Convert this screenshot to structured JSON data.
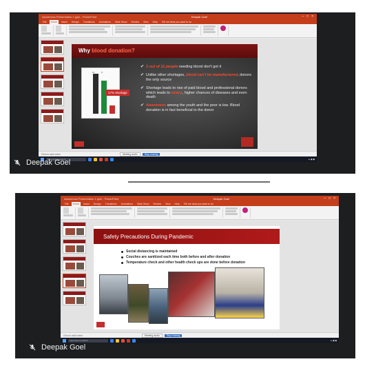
{
  "participants": [
    {
      "name": "Deepak Goel",
      "muted_icon": "mic-off-icon",
      "window": {
        "title": "Awareness Presentation 1.pptx - PowerPoint",
        "user": "Deepak Goel",
        "tabs": [
          "File",
          "Home",
          "Insert",
          "Design",
          "Transitions",
          "Animations",
          "Slide Show",
          "Review",
          "View",
          "Help",
          "Tell me what you want to do"
        ],
        "active_tab": "Home"
      },
      "slide": {
        "title_prefix": "Why ",
        "title_highlight": "blood donation?",
        "chart_labels": [
          "11",
          "9"
        ],
        "shortage_label": "17% shortage",
        "bullets": [
          {
            "em": "1 out of 11 people",
            "text": " needing blood don't get it"
          },
          {
            "pre": "Unlike other shortages, ",
            "em": "blood can't be manufactured",
            "text": ", donors the only source"
          },
          {
            "pre": "Shortage leads to rise of paid blood and professional donors which leads to ",
            "em": "stress",
            "text": ", higher chances of diseases and even death"
          },
          {
            "em": "Awareness",
            "text": " among the youth and the poor is low. Blood donation is in fact beneficial to the donor"
          }
        ]
      },
      "status": {
        "notes": "Click to add notes",
        "share": "Stop sharing",
        "mic": "Meeting audio"
      },
      "taskbar_search": "Type here to search"
    },
    {
      "name": "Deepak Goel",
      "muted_icon": "mic-off-icon",
      "window": {
        "title": "Awareness Presentation 1.pptx - PowerPoint",
        "user": "Deepak Goel",
        "tabs": [
          "File",
          "Home",
          "Insert",
          "Design",
          "Transitions",
          "Animations",
          "Slide Show",
          "Review",
          "View",
          "Help",
          "Tell me what you want to do"
        ],
        "active_tab": "Home"
      },
      "slide": {
        "title": "Safety Precautions During Pandemic",
        "bullets": [
          "Social distancing is maintained",
          "Couches are sanitized each time both before and after donation",
          "Temperature check and other health check ups are done before donation"
        ]
      },
      "status": {
        "notes": "Click to add notes",
        "share": "Stop sharing",
        "mic": "Meeting audio"
      },
      "taskbar_search": "Type here to search"
    }
  ],
  "colors": {
    "ppt_red": "#c43e1c",
    "slide_red": "#8c1010",
    "accent_red": "#ff4a2a",
    "tile_bg": "#1d1e20"
  }
}
